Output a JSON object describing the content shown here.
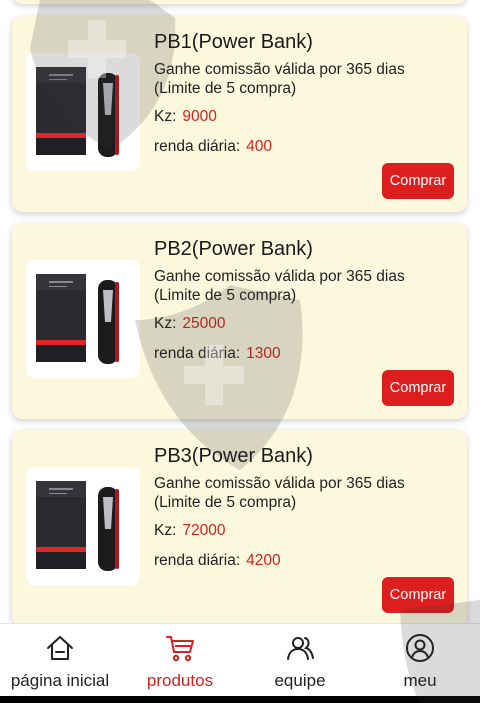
{
  "products": [
    {
      "name": "PB1(Power Bank)",
      "description": "Ganhe comissão válida por 365 dias (Limite de 5 compra)",
      "price_label": "Kz:",
      "price": "9000",
      "income_label": "renda diária:",
      "income": "400",
      "button": "Comprar",
      "image_icon": "power-bank-image"
    },
    {
      "name": "PB2(Power Bank)",
      "description": "Ganhe comissão válida por 365 dias (Limite de 5 compra)",
      "price_label": "Kz:",
      "price": "25000",
      "income_label": "renda diária:",
      "income": "1300",
      "button": "Comprar",
      "image_icon": "power-bank-image"
    },
    {
      "name": "PB3(Power Bank)",
      "description": "Ganhe comissão válida por 365 dias (Limite de 5 compra)",
      "price_label": "Kz:",
      "price": "72000",
      "income_label": "renda diária:",
      "income": "4200",
      "button": "Comprar",
      "image_icon": "power-bank-image"
    }
  ],
  "nav": [
    {
      "label": "página inicial",
      "icon": "home-icon",
      "active": false
    },
    {
      "label": "produtos",
      "icon": "cart-icon",
      "active": true
    },
    {
      "label": "equipe",
      "icon": "team-icon",
      "active": false
    },
    {
      "label": "meu",
      "icon": "profile-icon",
      "active": false
    }
  ],
  "colors": {
    "accent": "#dc1e1e",
    "card_bg": "#fbf8dd",
    "price_text": "#d4221e"
  }
}
